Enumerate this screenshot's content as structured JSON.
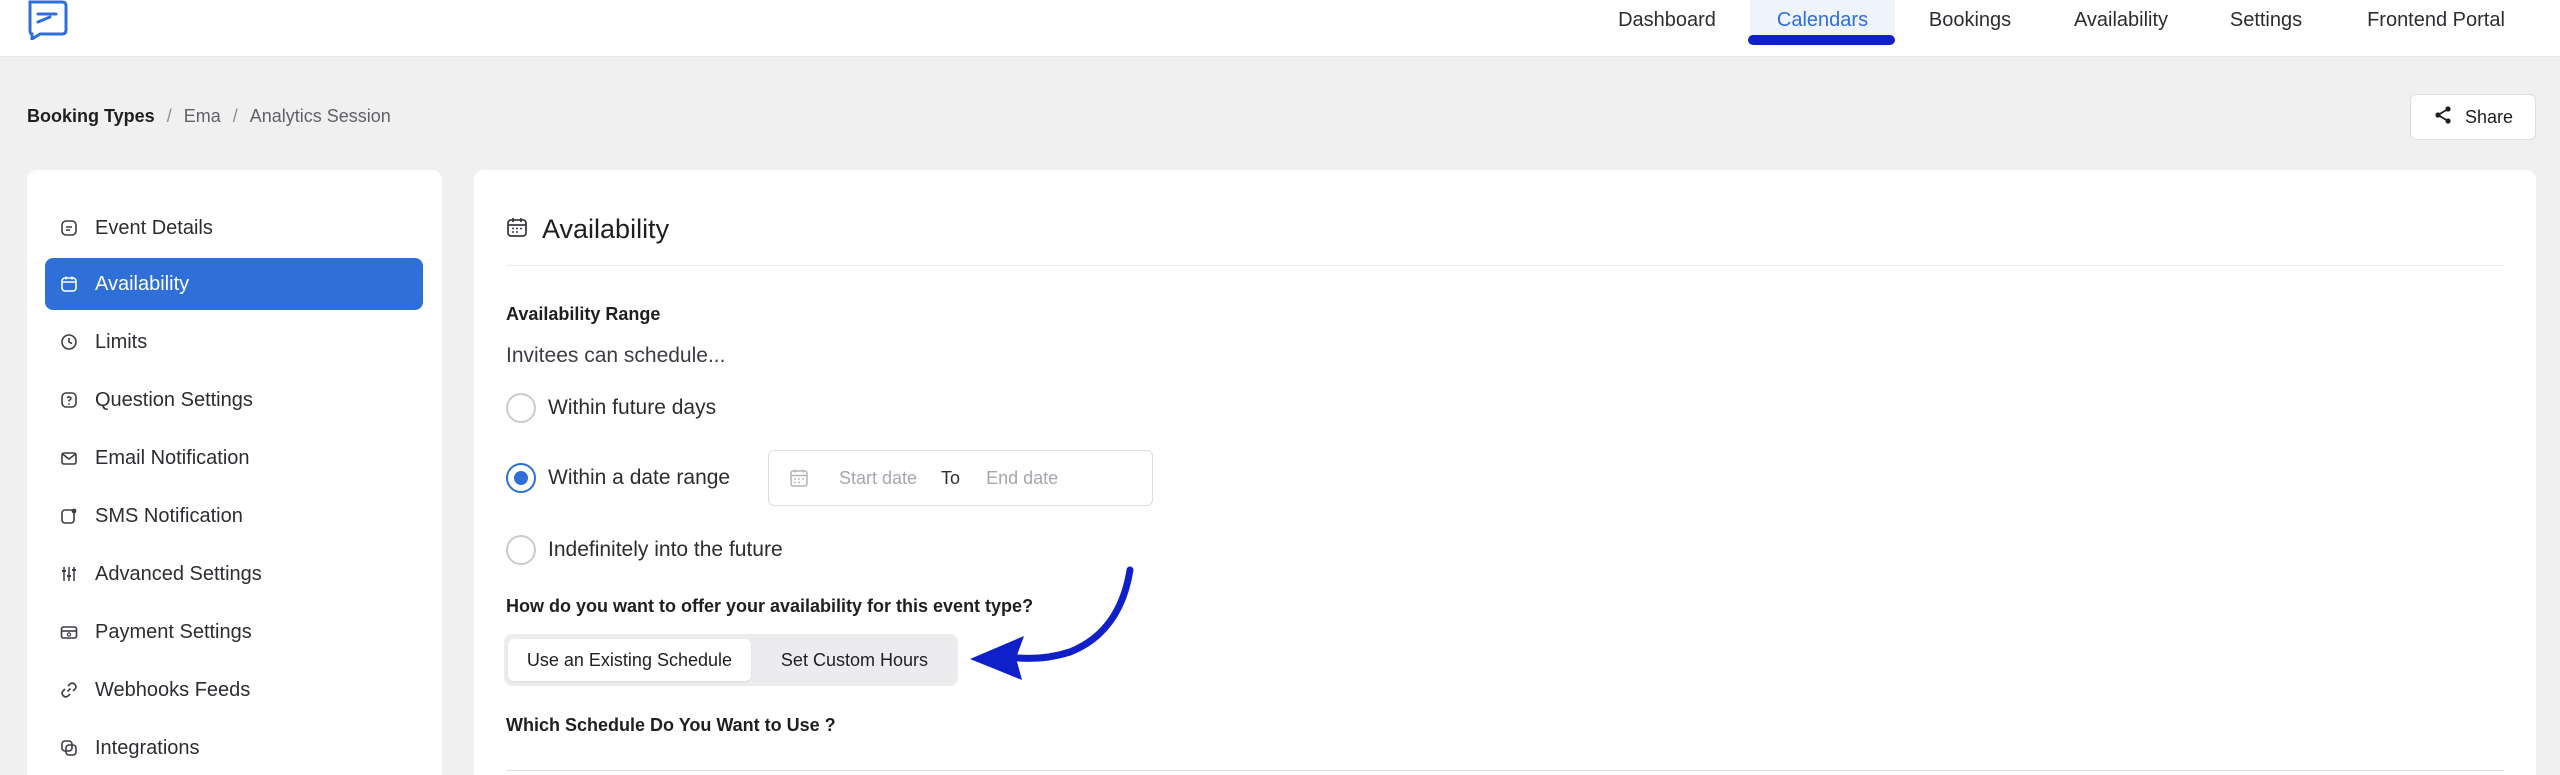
{
  "nav": {
    "items": [
      "Dashboard",
      "Calendars",
      "Bookings",
      "Availability",
      "Settings",
      "Frontend Portal"
    ],
    "active": "Calendars"
  },
  "breadcrumb": [
    "Booking Types",
    "Ema",
    "Analytics Session"
  ],
  "share_label": "Share",
  "sidebar": {
    "items": [
      {
        "label": "Event Details",
        "icon": "event-icon"
      },
      {
        "label": "Availability",
        "icon": "calendar-icon",
        "active": true
      },
      {
        "label": "Limits",
        "icon": "clock-icon"
      },
      {
        "label": "Question Settings",
        "icon": "question-icon"
      },
      {
        "label": "Email Notification",
        "icon": "mail-icon"
      },
      {
        "label": "SMS Notification",
        "icon": "sms-icon"
      },
      {
        "label": "Advanced Settings",
        "icon": "sliders-icon"
      },
      {
        "label": "Payment Settings",
        "icon": "payment-icon"
      },
      {
        "label": "Webhooks Feeds",
        "icon": "link-icon"
      },
      {
        "label": "Integrations",
        "icon": "integrations-icon"
      }
    ]
  },
  "panel": {
    "title": "Availability",
    "range_label": "Availability Range",
    "invitees_text": "Invitees can schedule...",
    "options": [
      "Within future days",
      "Within a date range",
      "Indefinitely into the future"
    ],
    "selected_option": "Within a date range",
    "start_placeholder": "Start date",
    "to_label": "To",
    "end_placeholder": "End date",
    "offer_question": "How do you want to offer your availability for this event type?",
    "segment": [
      "Use an Existing Schedule",
      "Set Custom Hours"
    ],
    "segment_active": "Use an Existing Schedule",
    "schedule_question": "Which Schedule Do You Want to Use ?"
  },
  "colors": {
    "accent": "#2e6fd8",
    "annotation_arrow": "#1020c8"
  }
}
